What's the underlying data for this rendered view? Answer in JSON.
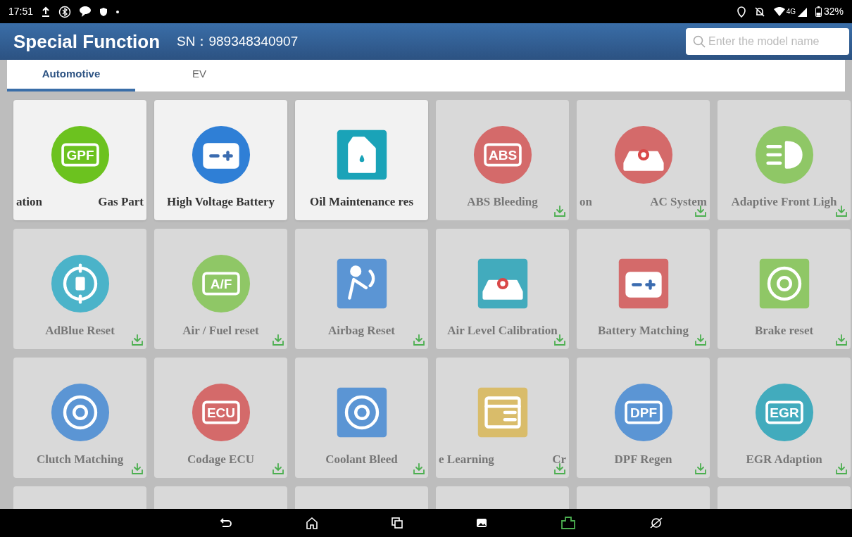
{
  "status_bar": {
    "time": "17:51",
    "network": "4G",
    "battery": "32%"
  },
  "header": {
    "title": "Special Function",
    "serial": "SN：989348340907",
    "search": {
      "placeholder": "Enter the model name"
    }
  },
  "tabs": [
    {
      "label": "Automotive",
      "selected": true
    },
    {
      "label": "EV",
      "selected": false
    }
  ],
  "tiles": [
    {
      "label_parts": [
        "ation",
        "Gas Part"
      ],
      "installed": true,
      "color": "#6cc21f",
      "kind": "badge",
      "icon_text": "GPF"
    },
    {
      "label_parts": [
        "High Voltage Battery"
      ],
      "installed": true,
      "color": "#2f7fd6",
      "kind": "battery"
    },
    {
      "label_parts": [
        "Oil Maintenance res"
      ],
      "installed": true,
      "color": "#1aa3b8",
      "kind": "oil"
    },
    {
      "label_parts": [
        "ABS Bleeding"
      ],
      "installed": false,
      "color": "#d46a6a",
      "kind": "badge",
      "icon_text": "ABS"
    },
    {
      "label_parts": [
        "on",
        "AC System"
      ],
      "installed": false,
      "color": "#d46a6a",
      "kind": "car"
    },
    {
      "label_parts": [
        "Adaptive Front Ligh"
      ],
      "installed": false,
      "color": "#8fc766",
      "kind": "light"
    },
    {
      "label_parts": [
        "AdBlue Reset"
      ],
      "installed": false,
      "color": "#4bb3c9",
      "kind": "gauge"
    },
    {
      "label_parts": [
        "Air / Fuel reset"
      ],
      "installed": false,
      "color": "#8fc766",
      "kind": "badge",
      "icon_text": "A/F"
    },
    {
      "label_parts": [
        "Airbag Reset"
      ],
      "installed": false,
      "color": "#5b95d4",
      "kind": "airbag"
    },
    {
      "label_parts": [
        "Air Level Calibration"
      ],
      "installed": false,
      "color": "#42abbd",
      "kind": "lift"
    },
    {
      "label_parts": [
        "Battery Matching"
      ],
      "installed": false,
      "color": "#d46a6a",
      "kind": "charger"
    },
    {
      "label_parts": [
        "Brake reset"
      ],
      "installed": false,
      "color": "#8fc766",
      "kind": "brake"
    },
    {
      "label_parts": [
        "Clutch Matching"
      ],
      "installed": false,
      "color": "#5b95d4",
      "kind": "clutch"
    },
    {
      "label_parts": [
        "Codage ECU"
      ],
      "installed": false,
      "color": "#d46a6a",
      "kind": "badge",
      "icon_text": "ECU"
    },
    {
      "label_parts": [
        "Coolant Bleed"
      ],
      "installed": false,
      "color": "#5b95d4",
      "kind": "coolant"
    },
    {
      "label_parts": [
        "e Learning",
        "Cr"
      ],
      "installed": false,
      "color": "#d9bc6a",
      "kind": "window"
    },
    {
      "label_parts": [
        "DPF Regen"
      ],
      "installed": false,
      "color": "#5b95d4",
      "kind": "badge",
      "icon_text": "DPF"
    },
    {
      "label_parts": [
        "EGR Adaption"
      ],
      "installed": false,
      "color": "#42abbd",
      "kind": "badge",
      "icon_text": "EGR"
    }
  ]
}
